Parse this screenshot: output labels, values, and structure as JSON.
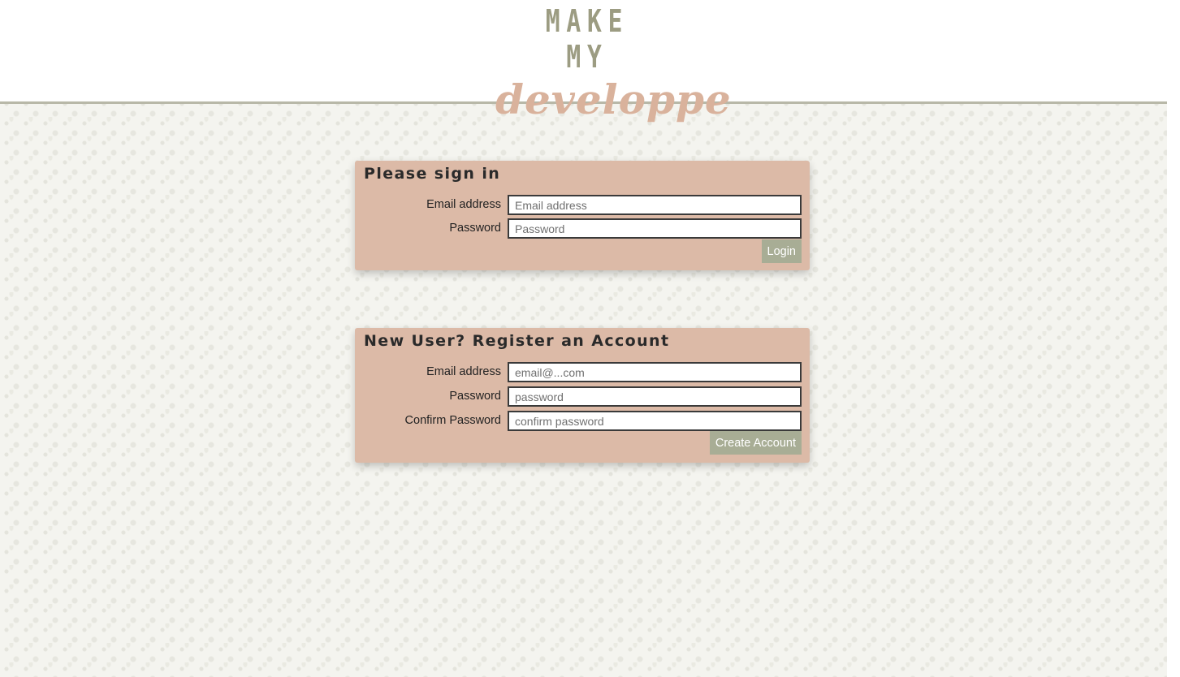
{
  "header": {
    "logo_line1": "MAKE MY",
    "logo_line2": "developpe"
  },
  "login": {
    "title": "Please sign in",
    "email_label": "Email address",
    "email_placeholder": "Email address",
    "password_label": "Password",
    "password_placeholder": "Password",
    "submit_label": "Login"
  },
  "register": {
    "title": "New User? Register an Account",
    "email_label": "Email address",
    "email_placeholder": "email@...com",
    "password_label": "Password",
    "password_placeholder": "password",
    "confirm_label": "Confirm Password",
    "confirm_placeholder": "confirm password",
    "submit_label": "Create Account"
  },
  "colors": {
    "header_logo_top": "#9c9c82",
    "header_logo_bottom": "#d9b29c",
    "panel_background": "#dcbaa7",
    "button_background": "#a8ad95",
    "page_background": "#f4f4ef"
  }
}
